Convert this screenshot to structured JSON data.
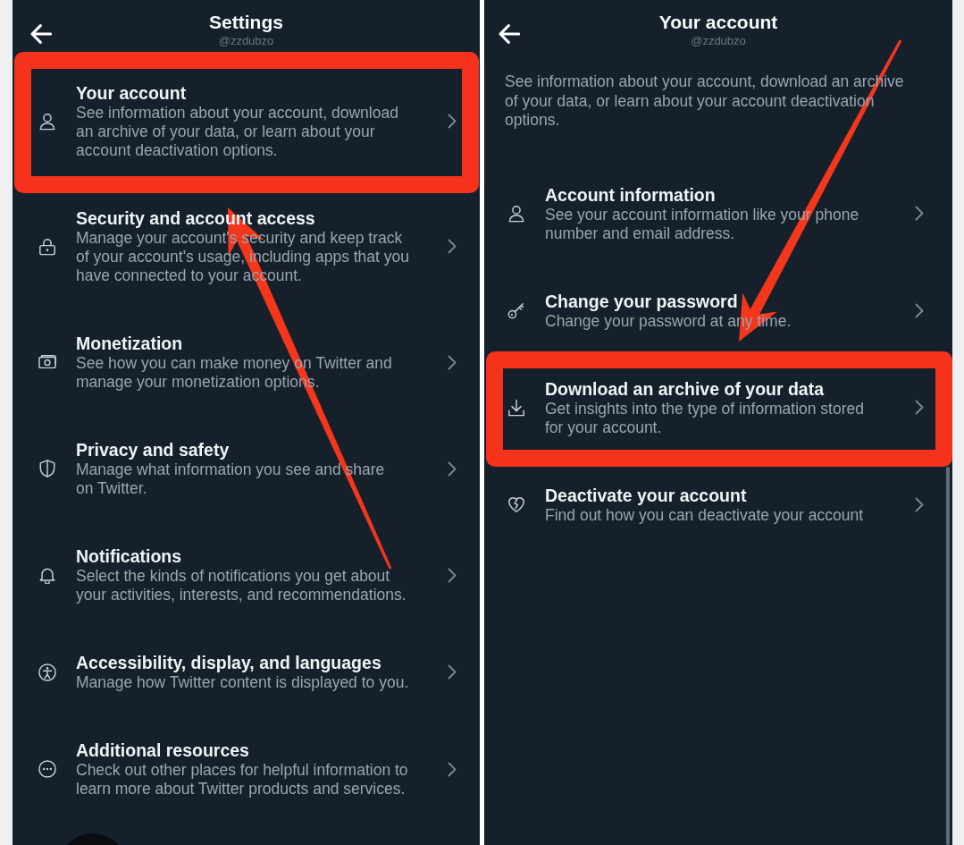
{
  "settings_screen": {
    "title": "Settings",
    "username": "@zzdubzo",
    "items": [
      {
        "title": "Your account",
        "description": "See information about your account, download an archive of your data, or learn about your account deactivation options.",
        "highlighted": true
      },
      {
        "title": "Security and account access",
        "description": "Manage your account's security and keep track of your account's usage, including apps that you have connected to your account.",
        "highlighted": false
      },
      {
        "title": "Monetization",
        "description": "See how you can make money on Twitter and manage your monetization options.",
        "highlighted": false
      },
      {
        "title": "Privacy and safety",
        "description": "Manage what information you see and share on Twitter.",
        "highlighted": false
      },
      {
        "title": "Notifications",
        "description": "Select the kinds of notifications you get about your activities, interests, and recommendations.",
        "highlighted": false
      },
      {
        "title": "Accessibility, display, and languages",
        "description": "Manage how Twitter content is displayed to you.",
        "highlighted": false
      },
      {
        "title": "Additional resources",
        "description": "Check out other places for helpful information to learn more about Twitter products and services.",
        "highlighted": false
      }
    ]
  },
  "account_screen": {
    "title": "Your account",
    "username": "@zzdubzo",
    "intro": "See information about your account, download an archive of your data, or learn about your account deactivation options.",
    "items": [
      {
        "title": "Account information",
        "description": "See your account information like your phone number and email address.",
        "highlighted": false
      },
      {
        "title": "Change your password",
        "description": "Change your password at any time.",
        "highlighted": false
      },
      {
        "title": "Download an archive of your data",
        "description": "Get insights into the type of information stored for your account.",
        "highlighted": true
      },
      {
        "title": "Deactivate your account",
        "description": "Find out how you can deactivate your account",
        "highlighted": false
      }
    ]
  }
}
